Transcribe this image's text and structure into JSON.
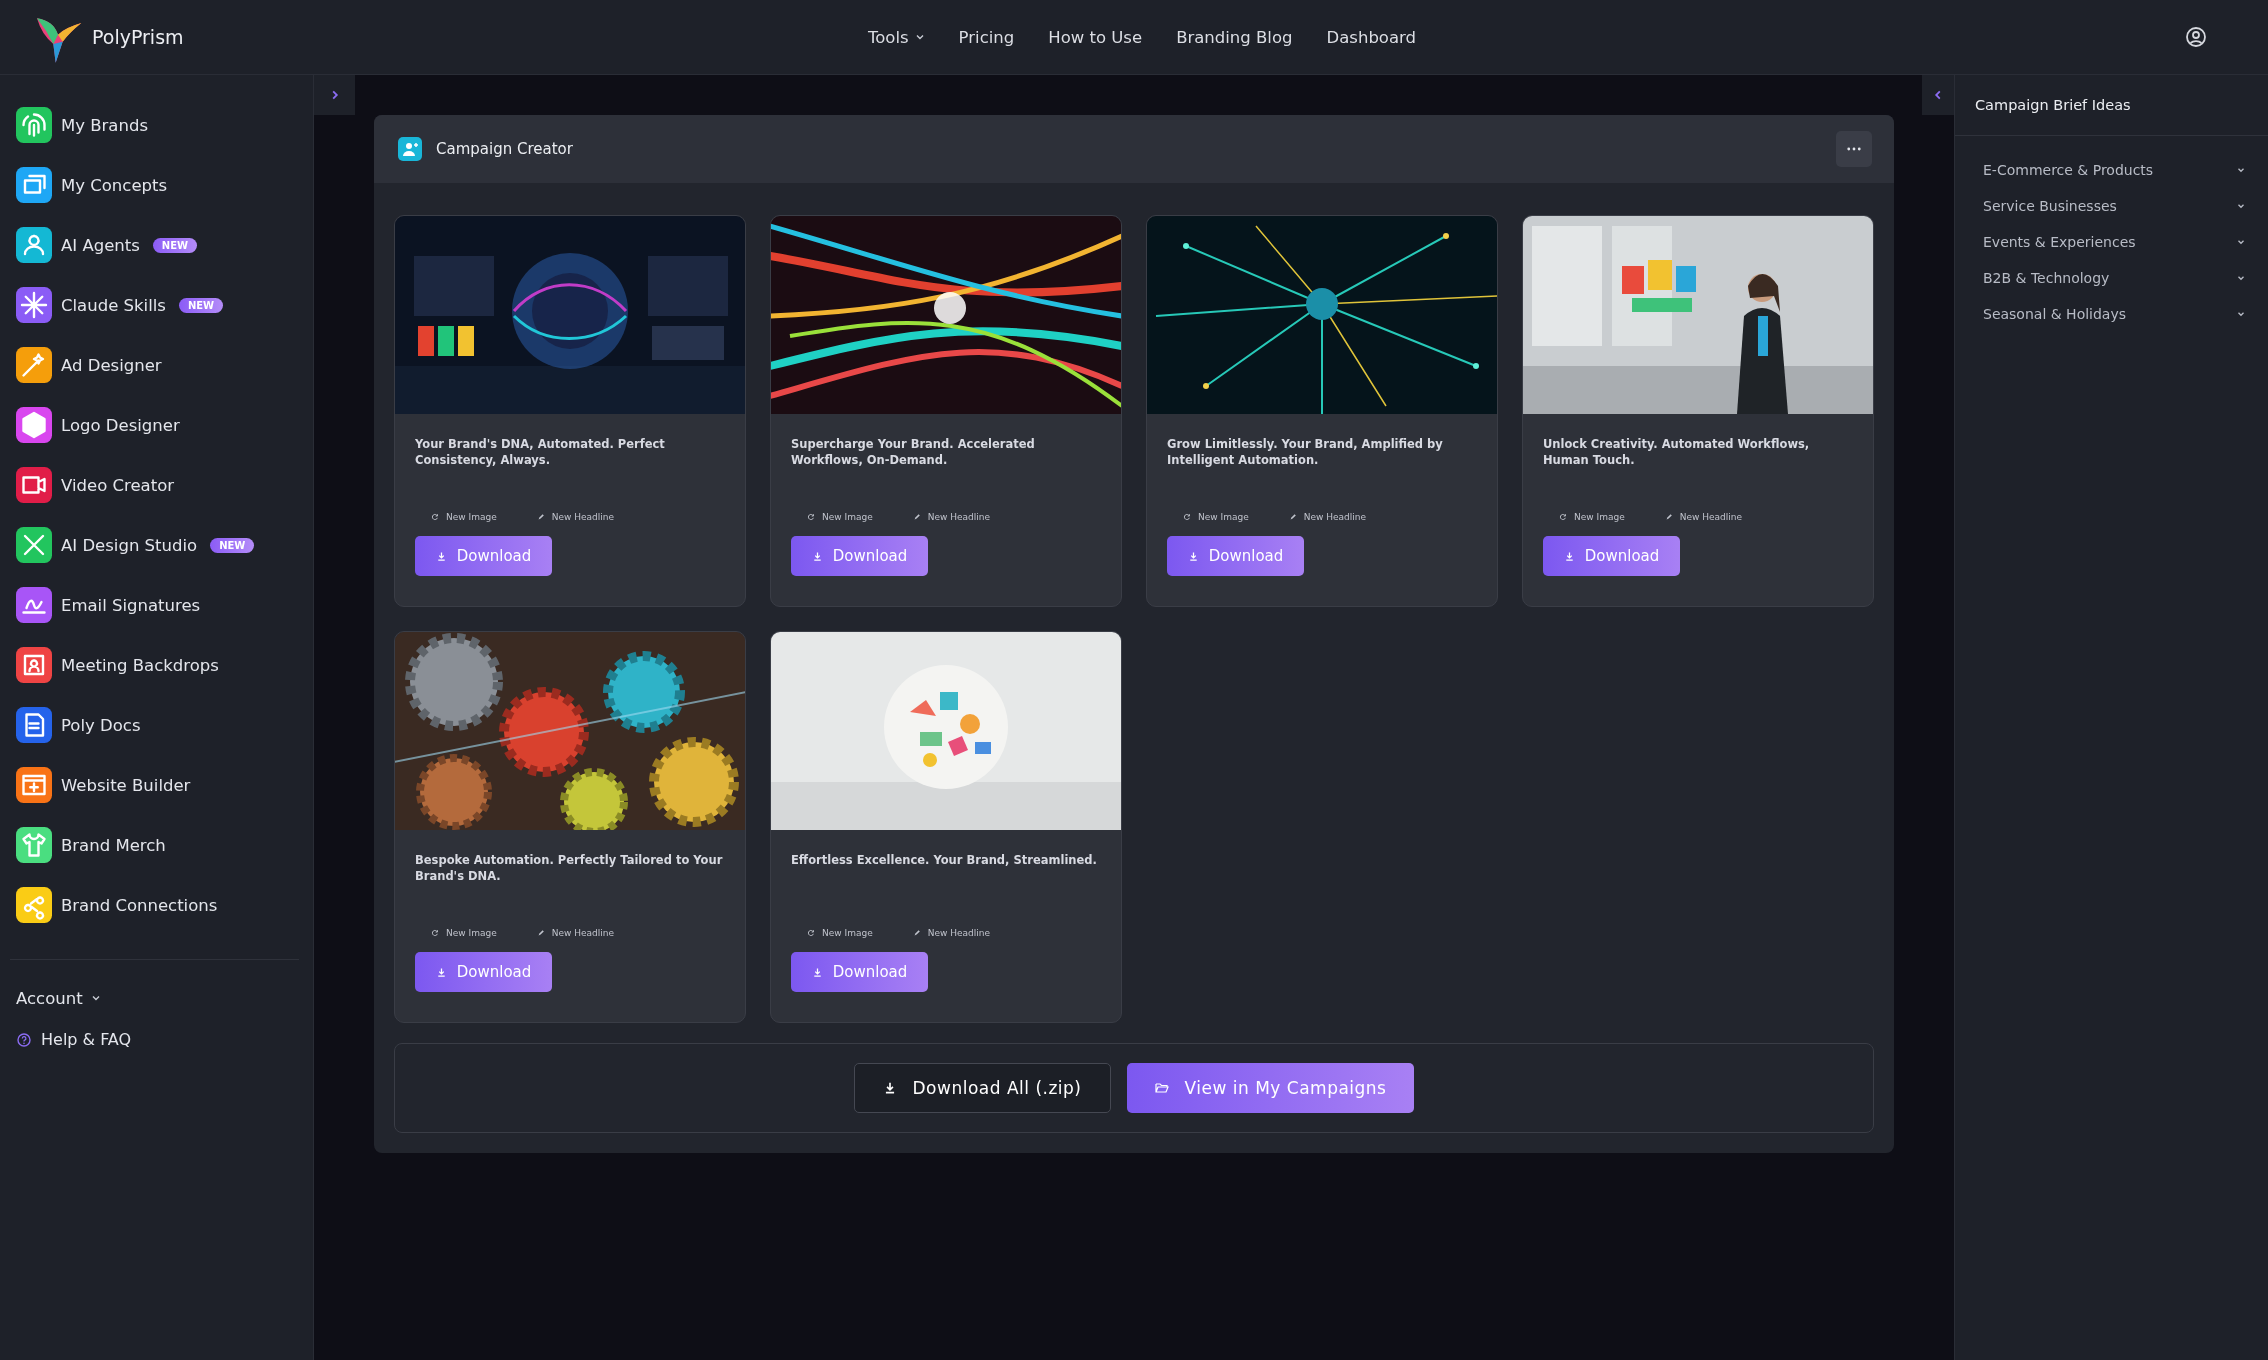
{
  "header": {
    "brand": "PolyPrism",
    "nav": [
      {
        "label": "Tools",
        "dropdown": true
      },
      {
        "label": "Pricing",
        "dropdown": false
      },
      {
        "label": "How to Use",
        "dropdown": false
      },
      {
        "label": "Branding Blog",
        "dropdown": false
      },
      {
        "label": "Dashboard",
        "dropdown": false
      }
    ]
  },
  "sidebar": {
    "items": [
      {
        "label": "My Brands",
        "color": "#22c55e"
      },
      {
        "label": "My Concepts",
        "color": "#1ea7f5"
      },
      {
        "label": "AI Agents",
        "color": "#14b8d4",
        "badge": "NEW"
      },
      {
        "label": "Claude Skills",
        "color": "#8b5cf6",
        "badge": "NEW"
      },
      {
        "label": "Ad Designer",
        "color": "#f59e0b"
      },
      {
        "label": "Logo Designer",
        "color": "#d946ef"
      },
      {
        "label": "Video Creator",
        "color": "#e11d48"
      },
      {
        "label": "AI Design Studio",
        "color": "#22c55e",
        "badge": "NEW"
      },
      {
        "label": "Email Signatures",
        "color": "#a855f7"
      },
      {
        "label": "Meeting Backdrops",
        "color": "#ef4444"
      },
      {
        "label": "Poly Docs",
        "color": "#2563eb"
      },
      {
        "label": "Website Builder",
        "color": "#f97316"
      },
      {
        "label": "Brand Merch",
        "color": "#4ade80"
      },
      {
        "label": "Brand Connections",
        "color": "#facc15"
      }
    ],
    "account": "Account",
    "help": "Help & FAQ"
  },
  "panel": {
    "title": "Campaign Creator",
    "cards": [
      {
        "title": "Your Brand's DNA, Automated. Perfect Consistency, Always.",
        "actions": [
          "New Image",
          "New Headline"
        ],
        "button": "Download"
      },
      {
        "title": "Supercharge Your Brand. Accelerated Workflows, On-Demand.",
        "actions": [
          "New Image",
          "New Headline"
        ],
        "button": "Download"
      },
      {
        "title": "Grow Limitlessly. Your Brand, Amplified by Intelligent Automation.",
        "actions": [
          "New Image",
          "New Headline"
        ],
        "button": "Download"
      },
      {
        "title": "Unlock Creativity. Automated Workflows, Human Touch.",
        "actions": [
          "New Image",
          "New Headline"
        ],
        "button": "Download"
      },
      {
        "title": "Bespoke Automation. Perfectly Tailored to Your Brand's DNA.",
        "actions": [
          "New Image",
          "New Headline"
        ],
        "button": "Download"
      },
      {
        "title": "Effortless Excellence. Your Brand, Streamlined.",
        "actions": [
          "New Image",
          "New Headline"
        ],
        "button": "Download"
      }
    ],
    "footer_buttons": [
      {
        "label": "Download All (.zip)",
        "kind": "outline"
      },
      {
        "label": "View in My Campaigns",
        "kind": "primary"
      }
    ]
  },
  "right_panel": {
    "title": "Campaign Brief Ideas",
    "items": [
      {
        "label": "E-Commerce & Products",
        "expanded": false
      },
      {
        "label": "Service Businesses",
        "expanded": false
      },
      {
        "label": "Events & Experiences",
        "expanded": false
      },
      {
        "label": "B2B & Technology",
        "expanded": false
      },
      {
        "label": "Seasonal & Holidays",
        "expanded": false
      }
    ]
  }
}
